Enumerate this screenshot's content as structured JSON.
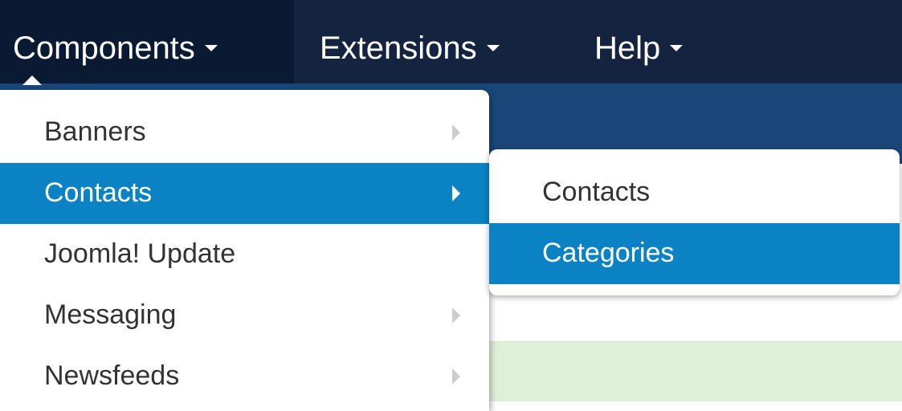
{
  "navbar": {
    "items": [
      {
        "label": "Components",
        "active": true
      },
      {
        "label": "Extensions",
        "active": false
      },
      {
        "label": "Help",
        "active": false
      }
    ]
  },
  "dropdown": {
    "items": [
      {
        "label": "Banners",
        "has_submenu": true,
        "active": false
      },
      {
        "label": "Contacts",
        "has_submenu": true,
        "active": true
      },
      {
        "label": "Joomla! Update",
        "has_submenu": false,
        "active": false
      },
      {
        "label": "Messaging",
        "has_submenu": true,
        "active": false
      },
      {
        "label": "Newsfeeds",
        "has_submenu": true,
        "active": false
      }
    ]
  },
  "submenu": {
    "items": [
      {
        "label": "Contacts",
        "active": false
      },
      {
        "label": "Categories",
        "active": true
      }
    ]
  },
  "colors": {
    "navbar_bg": "#14233f",
    "subheader_bg": "#19477a",
    "highlight": "#0a82c4",
    "alert_bg": "#dff0d8"
  }
}
